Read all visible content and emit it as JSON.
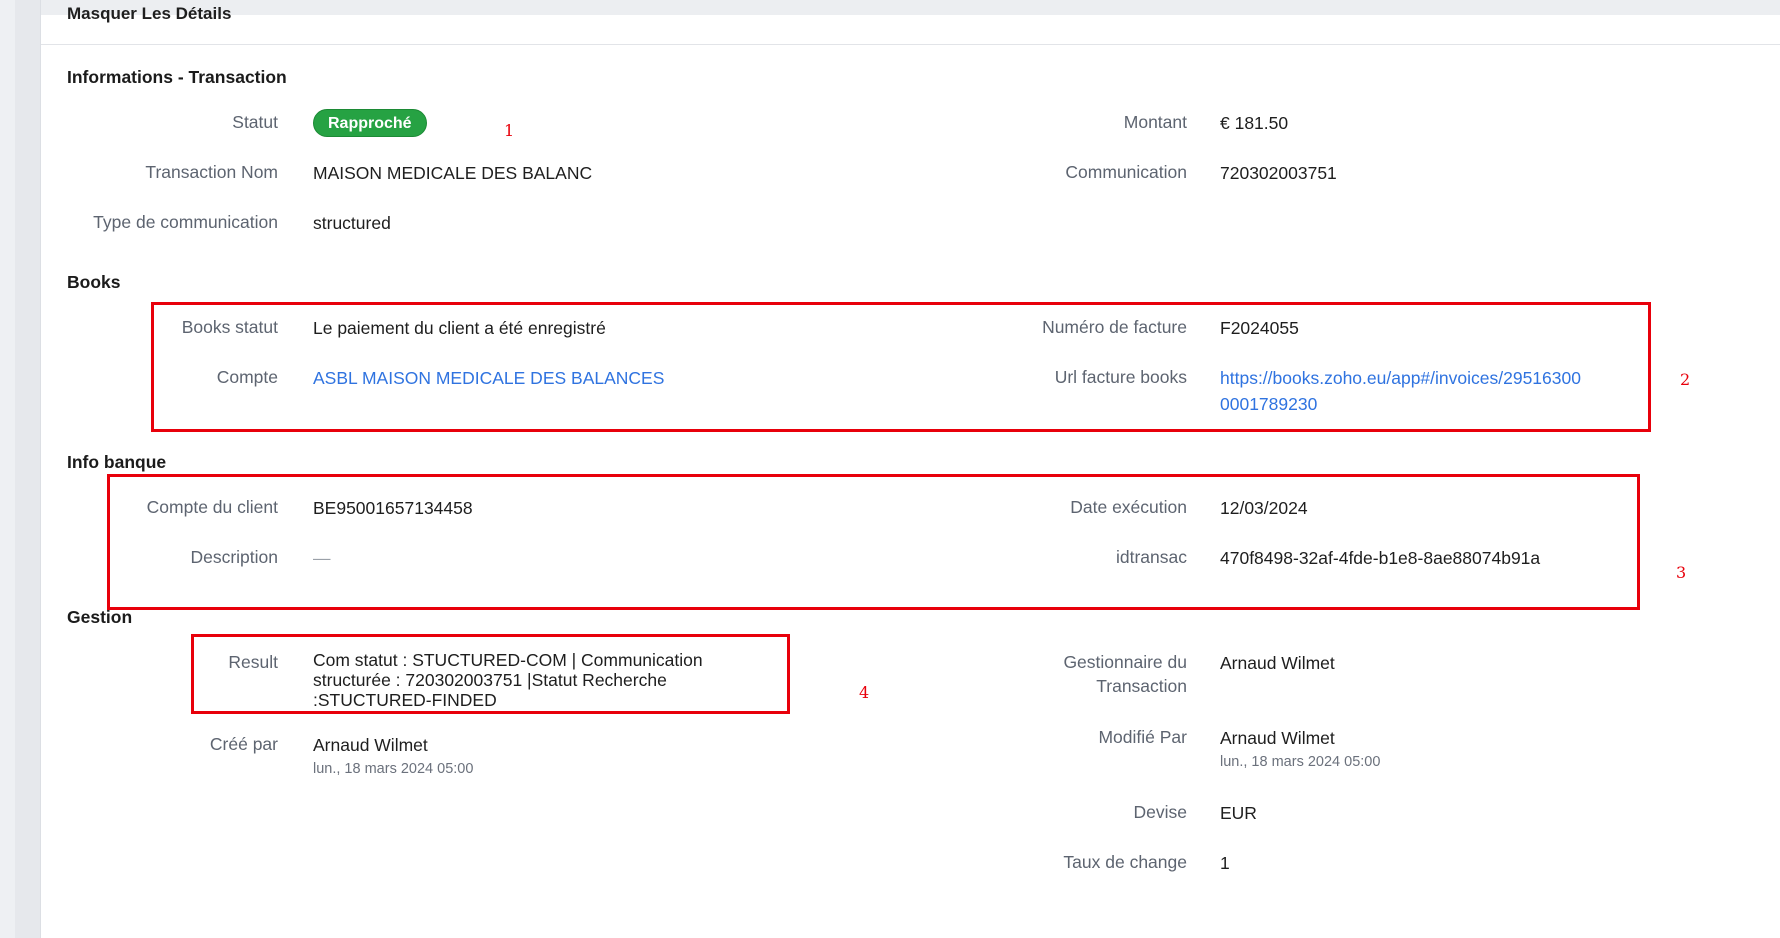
{
  "header": {
    "toggle_label": "Masquer Les Détails"
  },
  "sections": {
    "transaction": {
      "title": "Informations - Transaction",
      "statut_label": "Statut",
      "statut_badge": "Rapproché",
      "montant_label": "Montant",
      "montant_value": "€ 181.50",
      "nom_label": "Transaction Nom",
      "nom_value": "MAISON MEDICALE DES BALANC",
      "communication_label": "Communication",
      "communication_value": "720302003751",
      "type_label": "Type de communication",
      "type_value": "structured"
    },
    "books": {
      "title": "Books",
      "statut_label": "Books statut",
      "statut_value": "Le paiement du client a été enregistré",
      "facture_label": "Numéro de facture",
      "facture_value": "F2024055",
      "compte_label": "Compte",
      "compte_value": "ASBL MAISON MEDICALE DES BALANCES",
      "url_label": "Url facture books",
      "url_line1": "https://books.zoho.eu/app#/invoices/29516300",
      "url_line2": "0001789230"
    },
    "banque": {
      "title": "Info banque",
      "compte_label": "Compte du client",
      "compte_value": "BE95001657134458",
      "date_label": "Date exécution",
      "date_value": "12/03/2024",
      "description_label": "Description",
      "description_value": "—",
      "idtransac_label": "idtransac",
      "idtransac_value": "470f8498-32af-4fde-b1e8-8ae88074b91a"
    },
    "gestion": {
      "title": "Gestion",
      "result_label": "Result",
      "result_line1": "Com statut : STUCTURED-COM | Communication",
      "result_line2": "structurée : 720302003751 |Statut Recherche",
      "result_line3": ":STUCTURED-FINDED",
      "gestionnaire_label_line1": "Gestionnaire du",
      "gestionnaire_label_line2": "Transaction",
      "gestionnaire_value": "Arnaud Wilmet",
      "cree_label": "Créé par",
      "cree_value": "Arnaud Wilmet",
      "cree_date": "lun., 18 mars 2024 05:00",
      "modifie_label": "Modifié Par",
      "modifie_value": "Arnaud Wilmet",
      "modifie_date": "lun., 18 mars 2024 05:00",
      "devise_label": "Devise",
      "devise_value": "EUR",
      "taux_label": "Taux de change",
      "taux_value": "1"
    }
  },
  "annotations": {
    "a1": "1",
    "a2": "2",
    "a3": "3",
    "a4": "4"
  },
  "colors": {
    "accent_red": "#e8000b",
    "badge_green": "#26a243",
    "link_blue": "#2f73e0"
  }
}
